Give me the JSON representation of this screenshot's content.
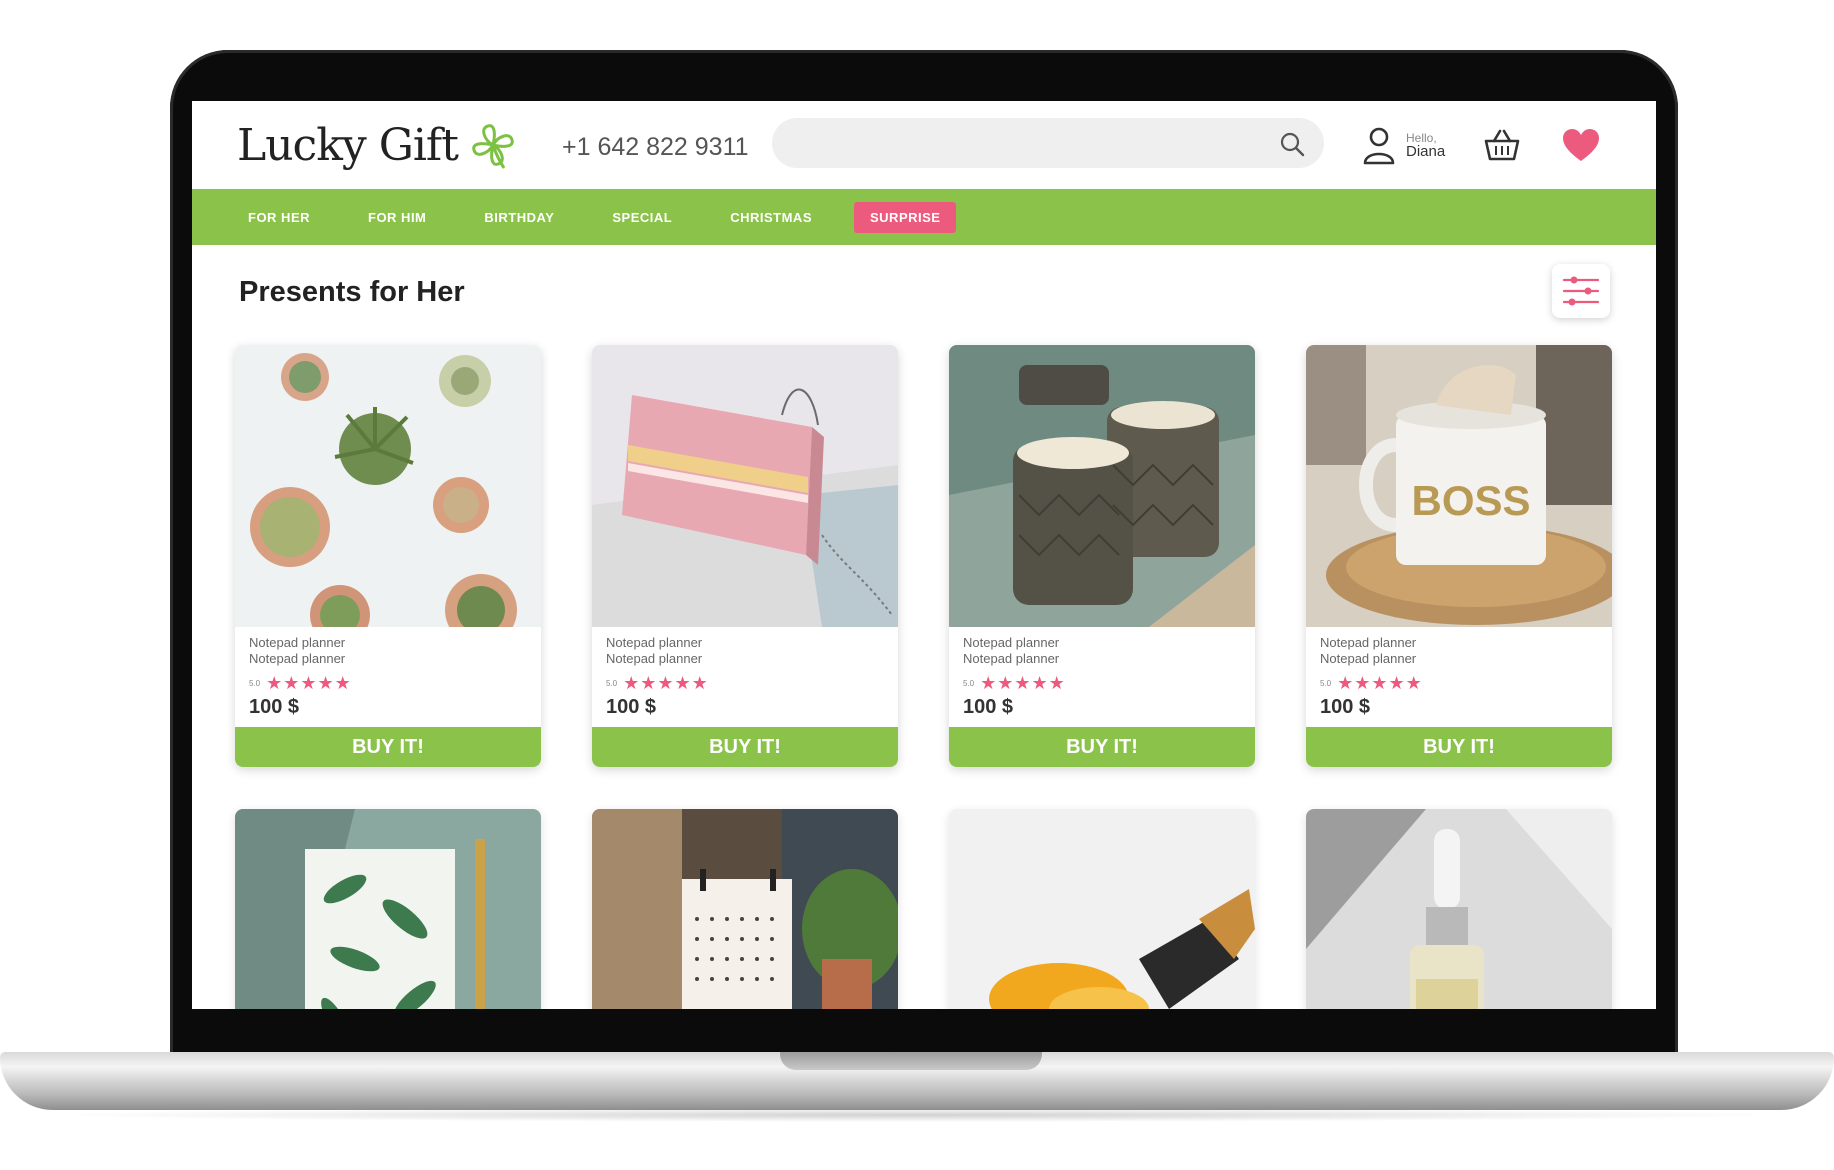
{
  "header": {
    "logo_text": "Lucky Gift",
    "phone": "+1 642 822 9311",
    "search_placeholder": "",
    "user": {
      "hello": "Hello,",
      "name": "Diana"
    }
  },
  "nav": {
    "items": [
      {
        "label": "FOR HER",
        "active": false
      },
      {
        "label": "FOR HIM",
        "active": false
      },
      {
        "label": "BIRTHDAY",
        "active": false
      },
      {
        "label": "SPECIAL",
        "active": false
      },
      {
        "label": "CHRISTMAS",
        "active": false
      },
      {
        "label": "SURPRISE",
        "active": true
      }
    ]
  },
  "page_title": "Presents for Her",
  "products": [
    {
      "line1": "Notepad planner",
      "line2": "Notepad planner",
      "rating": "5.0",
      "stars": "★★★★★",
      "price": "100 $",
      "button": "BUY IT!",
      "image": "succulents"
    },
    {
      "line1": "Notepad planner",
      "line2": "Notepad planner",
      "rating": "5.0",
      "stars": "★★★★★",
      "price": "100 $",
      "button": "BUY IT!",
      "image": "pink-handbag"
    },
    {
      "line1": "Notepad planner",
      "line2": "Notepad planner",
      "rating": "5.0",
      "stars": "★★★★★",
      "price": "100 $",
      "button": "BUY IT!",
      "image": "candles"
    },
    {
      "line1": "Notepad planner",
      "line2": "Notepad planner",
      "rating": "5.0",
      "stars": "★★★★★",
      "price": "100 $",
      "button": "BUY IT!",
      "image": "boss-mug"
    }
  ],
  "products_row2": [
    {
      "image": "leaf-notebook"
    },
    {
      "image": "desk-calendar"
    },
    {
      "image": "bath-salt"
    },
    {
      "image": "serum-bottle"
    }
  ],
  "mug_text": "BOSS",
  "colors": {
    "accent_green": "#8bc34a",
    "accent_pink": "#ec5b7e"
  }
}
